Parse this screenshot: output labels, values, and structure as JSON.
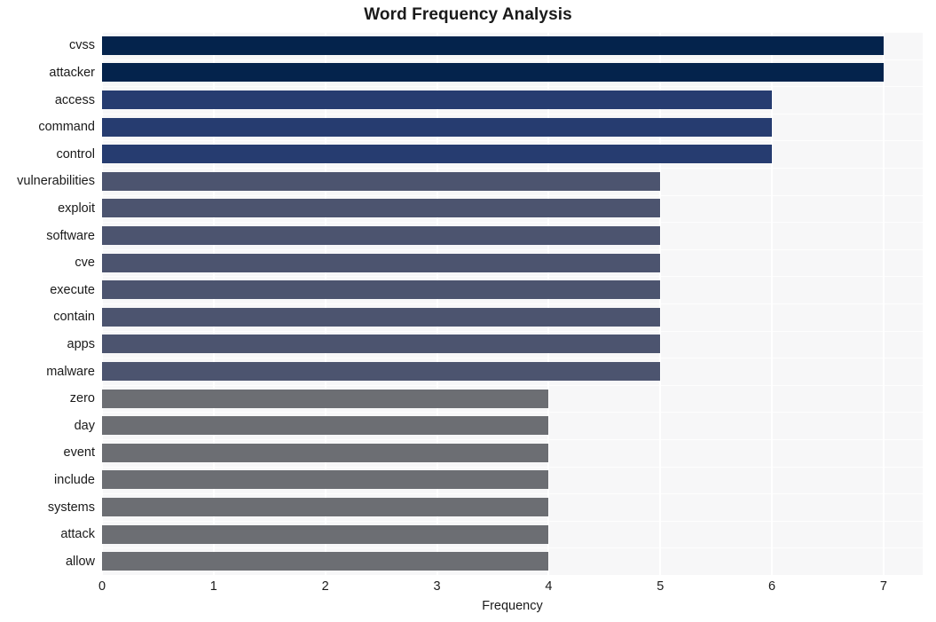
{
  "chart_data": {
    "type": "bar",
    "orientation": "horizontal",
    "title": "Word Frequency Analysis",
    "xlabel": "Frequency",
    "ylabel": "",
    "categories": [
      "cvss",
      "attacker",
      "access",
      "command",
      "control",
      "vulnerabilities",
      "exploit",
      "software",
      "cve",
      "execute",
      "contain",
      "apps",
      "malware",
      "zero",
      "day",
      "event",
      "include",
      "systems",
      "attack",
      "allow"
    ],
    "values": [
      7,
      7,
      6,
      6,
      6,
      5,
      5,
      5,
      5,
      5,
      5,
      5,
      5,
      4,
      4,
      4,
      4,
      4,
      4,
      4
    ],
    "bar_colors": [
      "#04234c",
      "#04234c",
      "#263c70",
      "#263c70",
      "#263c70",
      "#4c546f",
      "#4c546f",
      "#4c546f",
      "#4c546f",
      "#4c546f",
      "#4c546f",
      "#4c546f",
      "#4c546f",
      "#6c6e73",
      "#6c6e73",
      "#6c6e73",
      "#6c6e73",
      "#6c6e73",
      "#6c6e73",
      "#6c6e73"
    ],
    "xlim": [
      0,
      7.35
    ],
    "xticks": [
      0,
      1,
      2,
      3,
      4,
      5,
      6,
      7
    ],
    "xtick_labels": [
      "0",
      "1",
      "2",
      "3",
      "4",
      "5",
      "6",
      "7"
    ],
    "grid": true,
    "grid_axis": "both",
    "legend": false,
    "plot_background": "#f7f7f8",
    "figure_background": "#ffffff",
    "gridline_color": "#ffffff",
    "text_color": "#1a1a1a"
  }
}
